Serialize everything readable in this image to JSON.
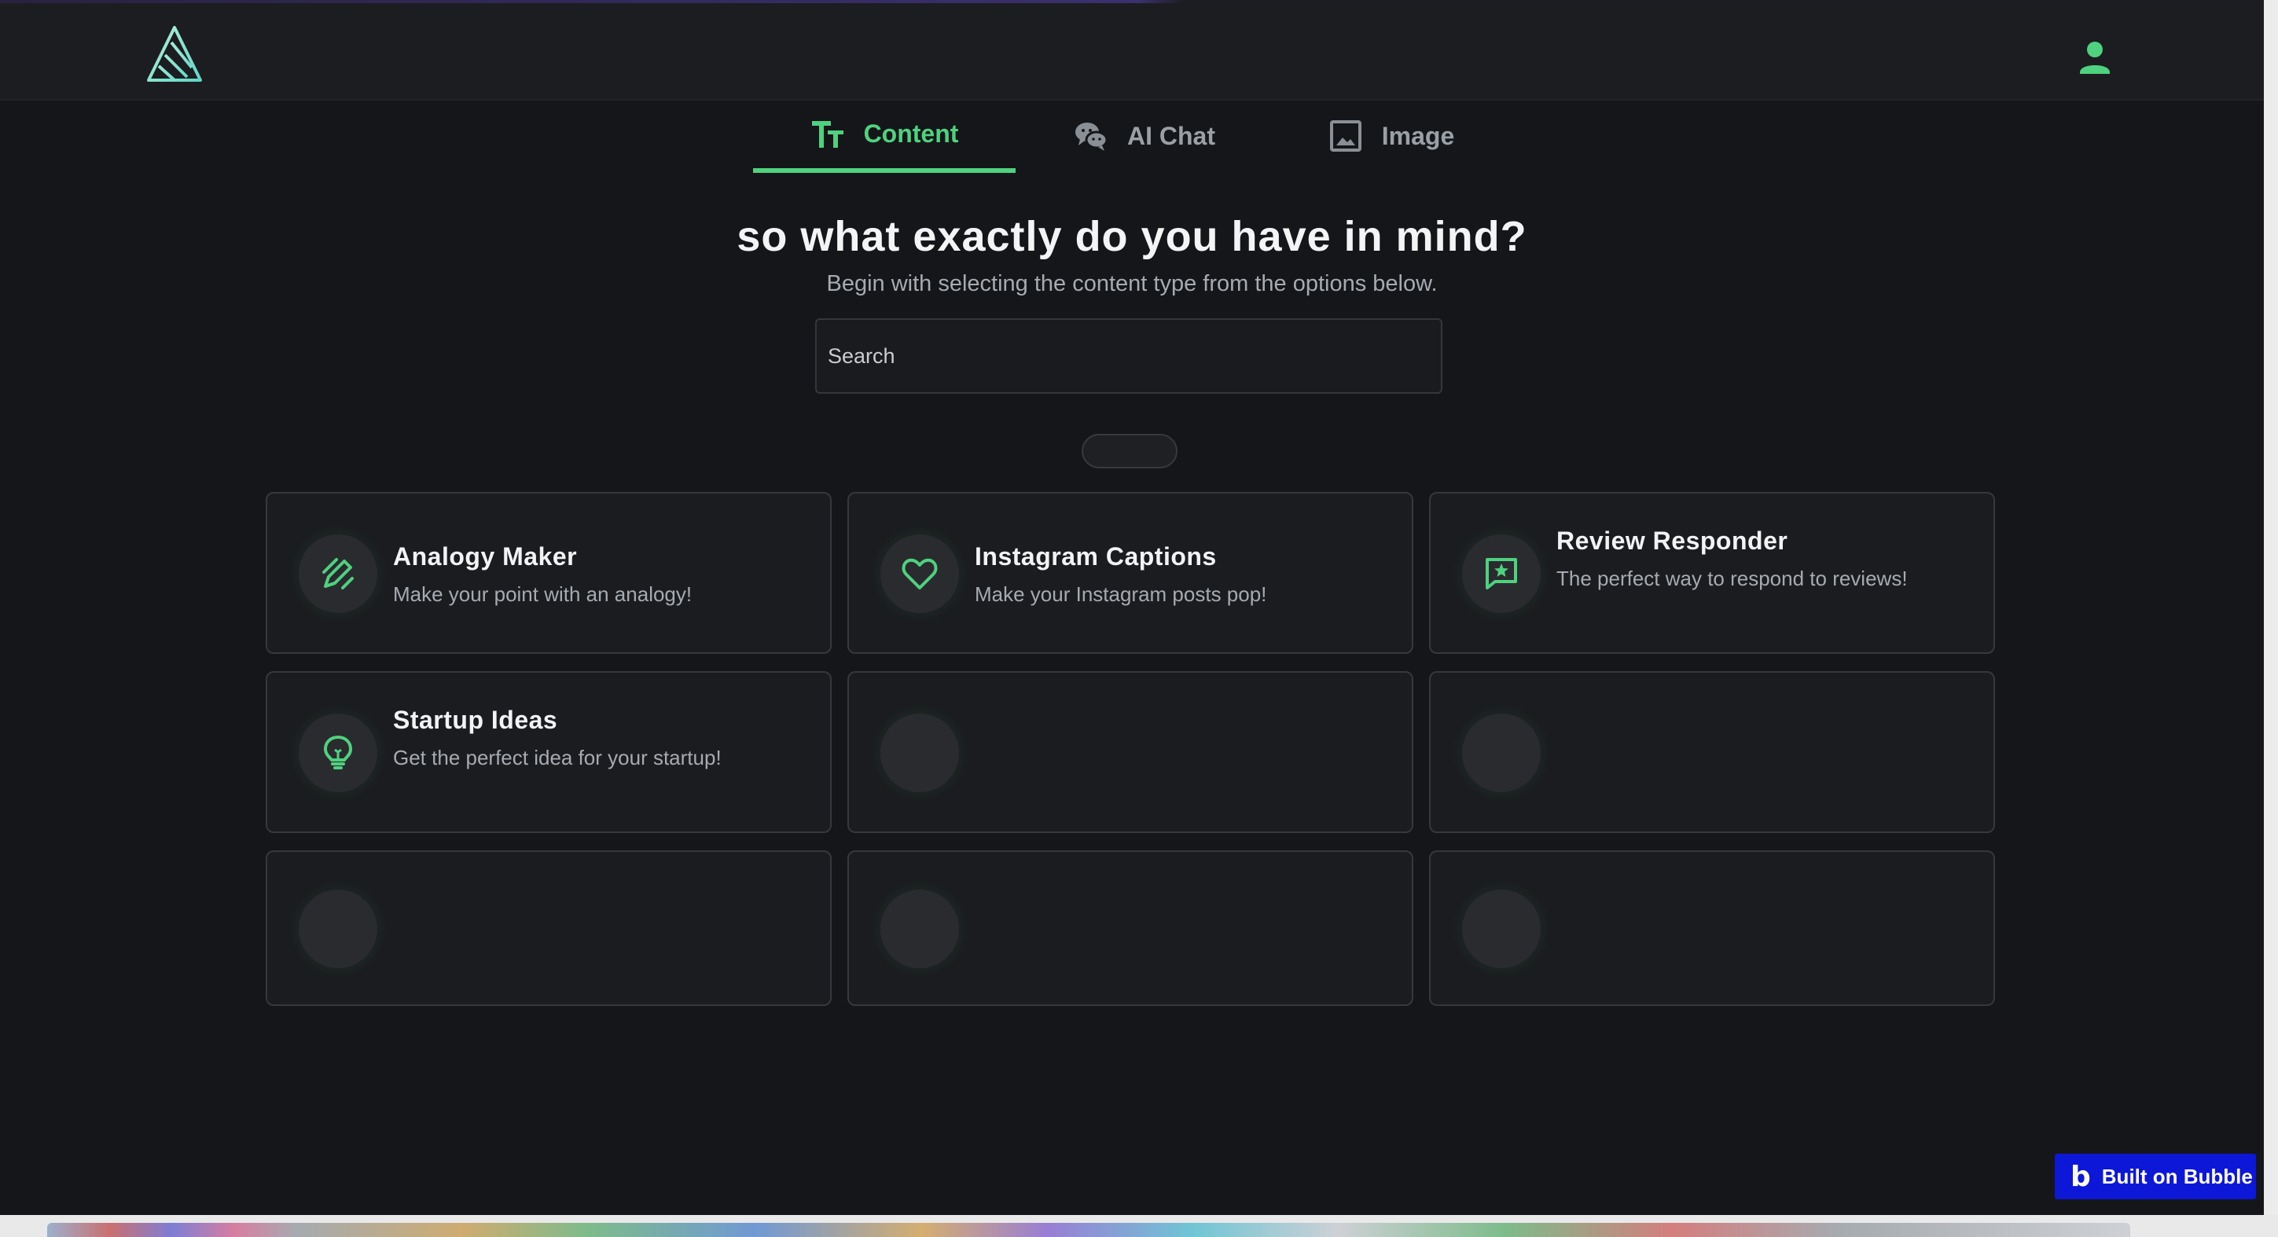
{
  "header": {
    "logo_icon": "triangle-logo-icon",
    "user_icon": "user-icon"
  },
  "tabs": [
    {
      "label": "Content",
      "icon": "text-format-icon",
      "active": true
    },
    {
      "label": "AI Chat",
      "icon": "chat-bubbles-icon",
      "active": false
    },
    {
      "label": "Image",
      "icon": "image-icon",
      "active": false
    }
  ],
  "hero": {
    "title": "so what exactly do you have in mind?",
    "subtitle": "Begin with selecting the content type from the options below."
  },
  "search": {
    "placeholder": "Search",
    "value": ""
  },
  "cards": [
    {
      "title": "Analogy Maker",
      "description": "Make your point with an analogy!",
      "icon": "pencil-ruler-icon"
    },
    {
      "title": "Instagram Captions",
      "description": "Make your Instagram posts pop!",
      "icon": "heart-icon"
    },
    {
      "title": "Review Responder",
      "description": "The perfect way to respond to reviews!",
      "icon": "star-message-icon"
    },
    {
      "title": "Startup Ideas",
      "description": "Get the perfect idea for your startup!",
      "icon": "lightbulb-icon"
    }
  ],
  "footer_badge": {
    "label": "Built on Bubble",
    "icon": "bubble-b-icon"
  },
  "colors": {
    "accent": "#4fd17f",
    "background": "#151619",
    "card": "#1b1c1f",
    "badge": "#0d17d8"
  }
}
